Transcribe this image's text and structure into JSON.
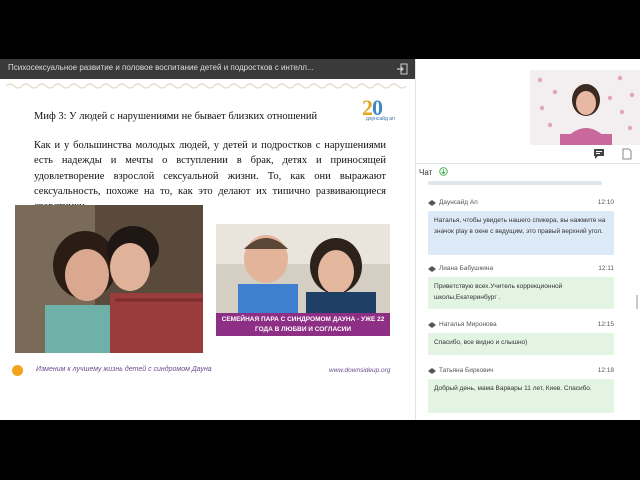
{
  "presentation": {
    "title": "Психосексуальное развитие и половое воспитание детей и подростков с интелл...",
    "exit_icon": "exit-icon"
  },
  "slide": {
    "heading": "Миф 3:  У людей с нарушениями не бывает близких отношений",
    "logo_number_a": "2",
    "logo_number_b": "0",
    "logo_text": "даунсайд ап",
    "body": "Как и у большинства молодых людей, у детей и подростков с нарушениями есть надежды и мечты о вступлении в брак, детях и приносящей удовлетворение взрослой сексуальной жизни. То, как они выражают сексуальность, похоже на то, как это делают их типично развивающиеся сверстники.",
    "photo_caption": "СЕМЕЙНАЯ ПАРА С СИНДРОМОМ ДАУНА - УЖЕ 22 ГОДА В ЛЮБВИ И СОГЛАСИИ",
    "footer_left": "Изменим к лучшему жизнь детей с синдромом Дауна",
    "footer_right": "www.downsideup.org"
  },
  "chat": {
    "title": "Чат",
    "messages": [
      {
        "author": "Даунсайд Ап",
        "time": "12:10",
        "text": "Наталья, чтобы увидеть нашего спикера, вы нажмите на значок play в окне с ведущим, это правый верхний угол.",
        "style": "blue"
      },
      {
        "author": "Лиана Бабушкина",
        "time": "12:11",
        "text": "Приветствую всех.Учитель коррекционной школы,Екатеринбург .",
        "style": "green"
      },
      {
        "author": "Наталья Миронова",
        "time": "12:15",
        "text": "Спасибо, все видно и слышно)",
        "style": "green"
      },
      {
        "author": "Татьяна Биркович",
        "time": "12:18",
        "text": "Добрый день, мама Варвары 11 лет, Киев. Спасибо.",
        "style": "green"
      }
    ]
  },
  "colors": {
    "header_bg": "#3a3a3a",
    "caption_bg": "#8e2f86",
    "bubble_blue": "#dceaf7",
    "bubble_green": "#e3f4e3",
    "accent_orange": "#f2a51b"
  }
}
